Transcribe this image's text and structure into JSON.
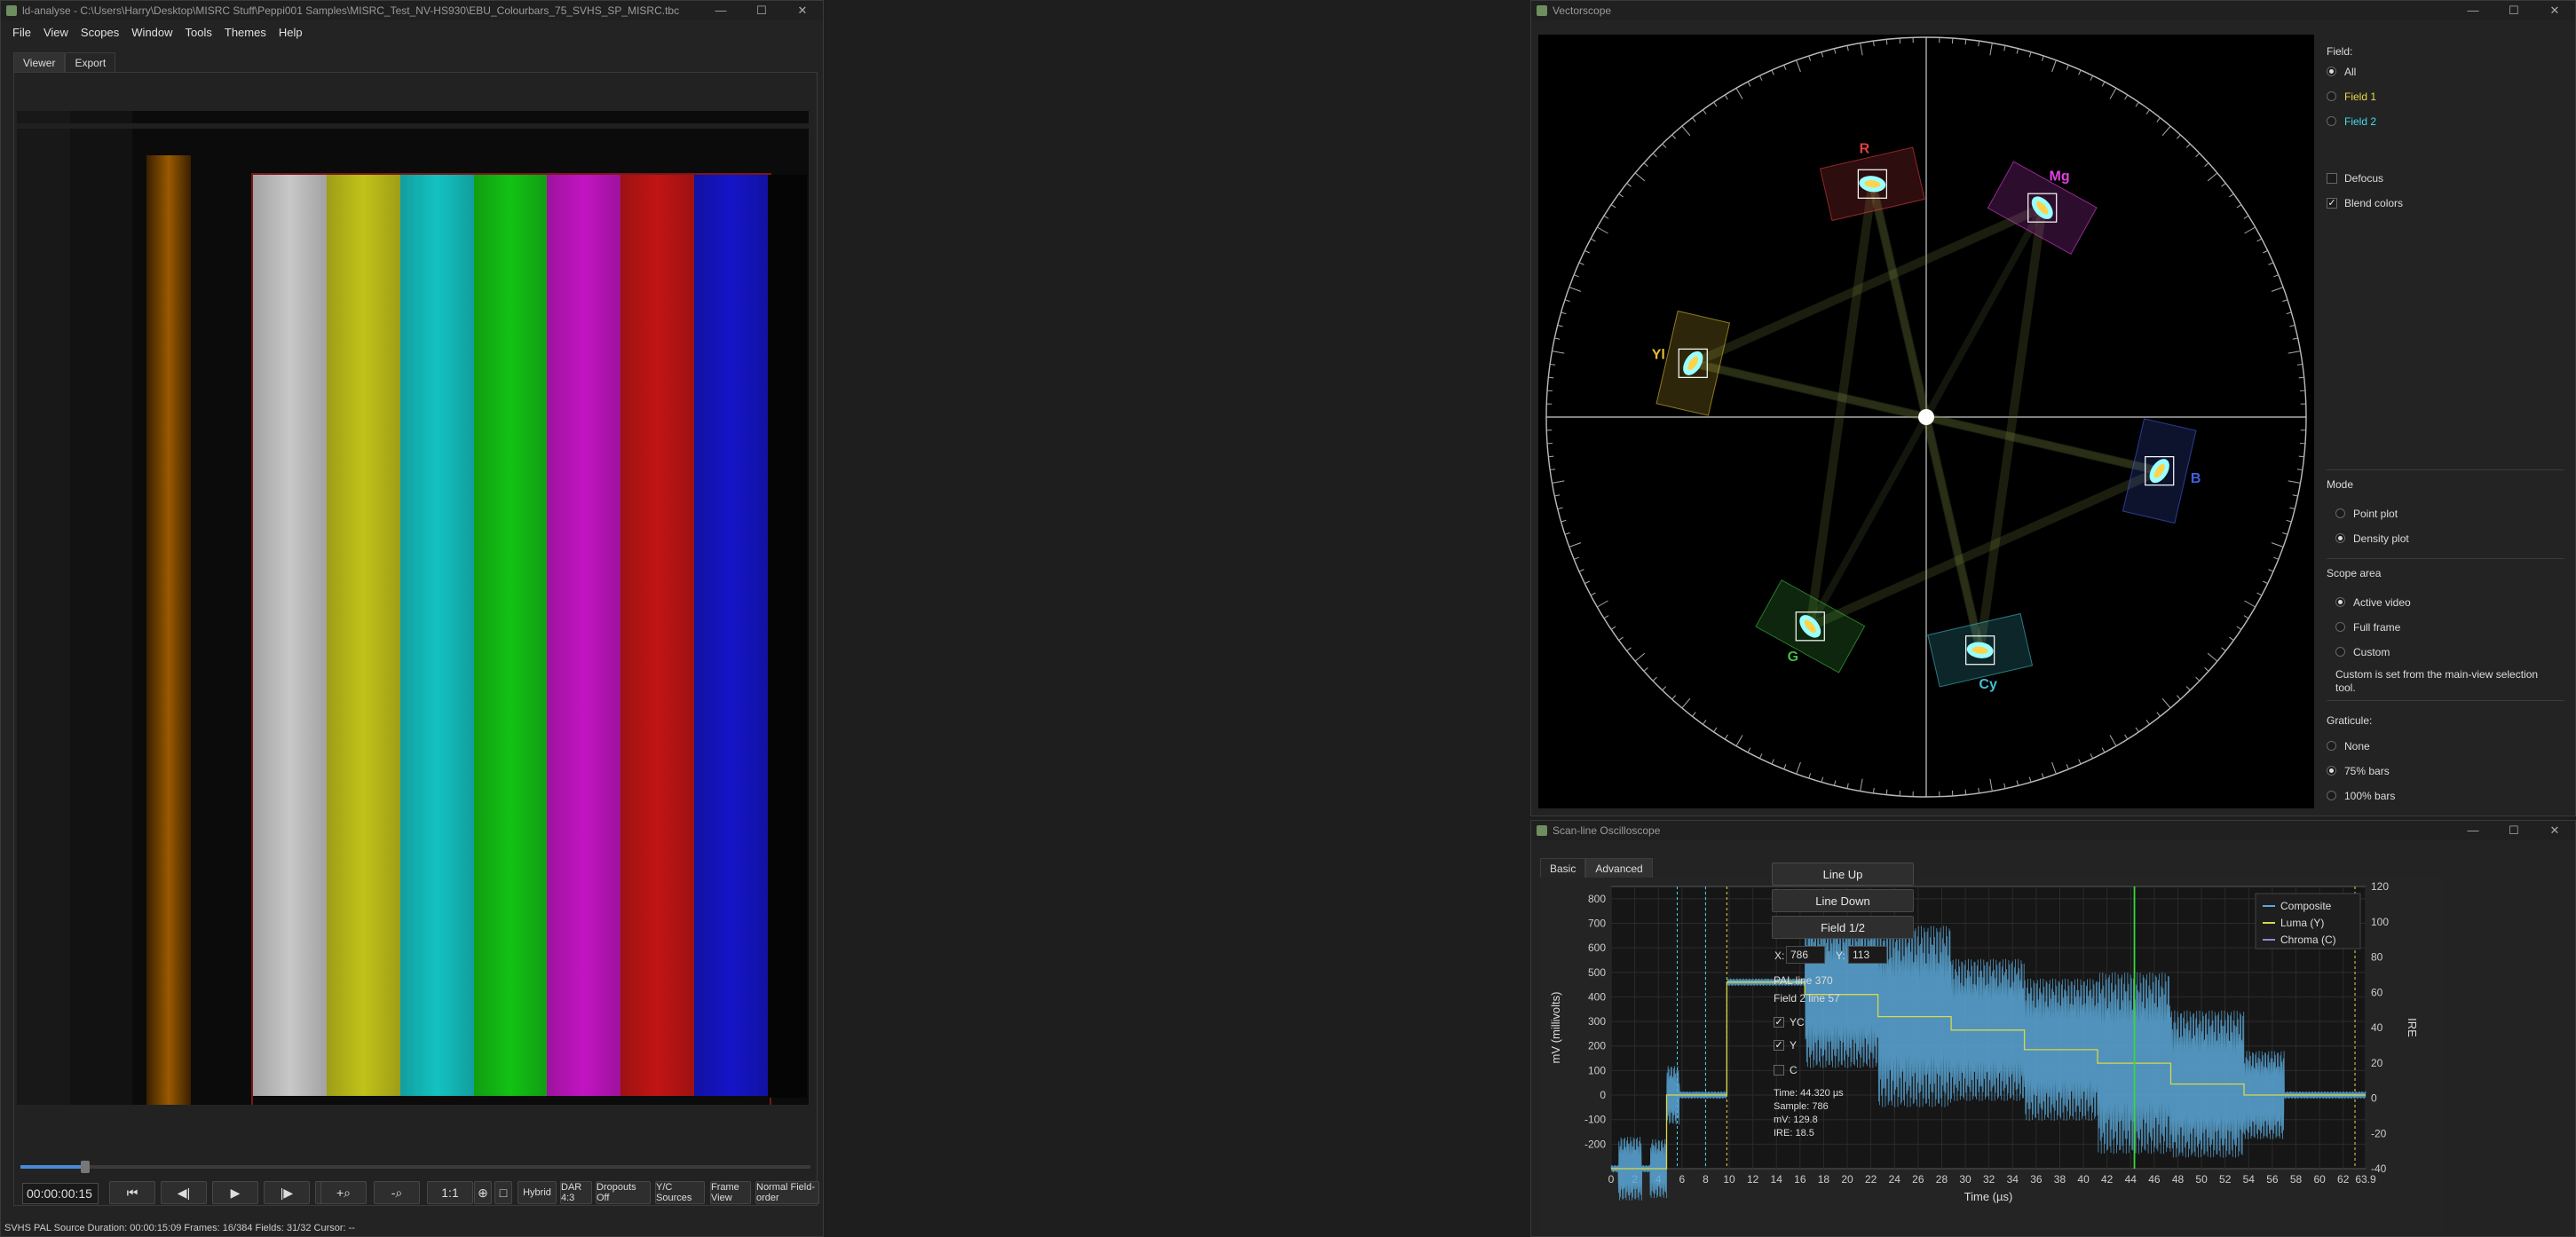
{
  "main": {
    "title": "ld-analyse - C:\\Users\\Harry\\Desktop\\MISRC Stuff\\Peppi001 Samples\\MISRC_Test_NV-HS930\\EBU_Colourbars_75_SVHS_SP_MISRC.tbc",
    "menu": [
      "File",
      "View",
      "Scopes",
      "Window",
      "Tools",
      "Themes",
      "Help"
    ],
    "tabs": [
      "Viewer",
      "Export"
    ],
    "timecode": "00:00:00:15",
    "transport": [
      "⏮",
      "◀|",
      "▶",
      "|▶",
      "⏭"
    ],
    "zoom": [
      "+⌕",
      "-⌕",
      "1:1"
    ],
    "toggles": [
      "Hybrid",
      "DAR 4:3",
      "Dropouts Off",
      "Y/C Sources",
      "Frame View",
      "Normal Field-order"
    ],
    "status": "SVHS PAL Source Duration: 00:00:15:09   Frames: 16/384 Fields: 31/32   Cursor: --",
    "bars": [
      "#c8c8c8",
      "#c2c21a",
      "#14c2c2",
      "#12c214",
      "#c214c2",
      "#c21414",
      "#1414c8"
    ]
  },
  "vectorscope": {
    "title": "Vectorscope",
    "field_label": "Field:",
    "field_options": [
      "All",
      "Field 1",
      "Field 2"
    ],
    "defocus": "Defocus",
    "blend": "Blend colors",
    "mode_label": "Mode",
    "mode_options": [
      "Point plot",
      "Density plot"
    ],
    "area_label": "Scope area",
    "area_options": [
      "Active video",
      "Full frame",
      "Custom"
    ],
    "custom_note": "Custom is set from the main-view selection tool.",
    "graticule_label": "Graticule:",
    "graticule_options": [
      "None",
      "75% bars",
      "100% bars"
    ],
    "targets": [
      {
        "name": "R",
        "angle": 103,
        "color": "#e04040"
      },
      {
        "name": "Mg",
        "angle": 61,
        "color": "#e040e0"
      },
      {
        "name": "B",
        "angle": -13,
        "color": "#4060e0"
      },
      {
        "name": "Cy",
        "angle": -77,
        "color": "#40c0d0"
      },
      {
        "name": "G",
        "angle": -119,
        "color": "#40c040"
      },
      {
        "name": "Yl",
        "angle": 167,
        "color": "#e0c030"
      }
    ]
  },
  "oscilloscope": {
    "title": "Scan-line Oscilloscope",
    "tabs": [
      "Basic",
      "Advanced"
    ],
    "buttons": [
      "Line Up",
      "Line Down",
      "Field 1/2"
    ],
    "x_label": "X:",
    "x_value": "786",
    "y_label": "Y:",
    "y_value": "113",
    "pal_line": "PAL line 370",
    "field_line": "Field 2 line 57",
    "yc": "YC",
    "y": "Y",
    "c": "C",
    "readout": [
      "Time: 44.320 µs",
      "Sample: 786",
      "mV: 129.8",
      "IRE: 18.5"
    ],
    "legend": [
      "Composite",
      "Luma (Y)",
      "Chroma (C)"
    ],
    "xlabel": "Time (µs)",
    "ylabel": "mV (millivolts)",
    "ylabel2": "IRE"
  },
  "chart_data": {
    "type": "line",
    "xlabel": "Time (µs)",
    "ylabel": "mV (millivolts)",
    "ylabel2": "IRE",
    "xlim": [
      0,
      63.9
    ],
    "ylim": [
      -300,
      850
    ],
    "ylim2": [
      -40,
      120
    ],
    "x_ticks": [
      "0",
      "2",
      "4",
      "6",
      "8",
      "10",
      "12",
      "14",
      "16",
      "18",
      "20",
      "22",
      "24",
      "26",
      "28",
      "30",
      "32",
      "34",
      "36",
      "38",
      "40",
      "42",
      "44",
      "46",
      "48",
      "50",
      "52",
      "54",
      "56",
      "58",
      "60",
      "62",
      "63.9"
    ],
    "y_ticks": [
      -200,
      -100,
      0,
      100,
      200,
      300,
      400,
      500,
      600,
      700,
      800
    ],
    "y2_ticks": [
      -40,
      -20,
      0,
      20,
      40,
      60,
      80,
      100,
      120
    ],
    "cursor_x": 44.32,
    "luma_segments": [
      {
        "x0": 0,
        "x1": 4.7,
        "v": -300
      },
      {
        "x0": 4.7,
        "x1": 9.8,
        "v": 0
      },
      {
        "x0": 9.8,
        "x1": 16.4,
        "v": 460
      },
      {
        "x0": 16.4,
        "x1": 22.6,
        "v": 410
      },
      {
        "x0": 22.6,
        "x1": 28.8,
        "v": 320
      },
      {
        "x0": 28.8,
        "x1": 35.0,
        "v": 265
      },
      {
        "x0": 35.0,
        "x1": 41.2,
        "v": 185
      },
      {
        "x0": 41.2,
        "x1": 47.4,
        "v": 130
      },
      {
        "x0": 47.4,
        "x1": 53.6,
        "v": 45
      },
      {
        "x0": 53.6,
        "x1": 63.9,
        "v": 0
      }
    ],
    "chroma_amplitude": [
      {
        "x0": 0.6,
        "x1": 2.6,
        "a": 130
      },
      {
        "x0": 3.3,
        "x1": 5.8,
        "a": 120
      },
      {
        "x0": 16.4,
        "x1": 22.6,
        "a": 300
      },
      {
        "x0": 22.6,
        "x1": 28.8,
        "a": 370
      },
      {
        "x0": 28.8,
        "x1": 35.0,
        "a": 290
      },
      {
        "x0": 35.0,
        "x1": 41.2,
        "a": 290
      },
      {
        "x0": 41.2,
        "x1": 47.4,
        "a": 370
      },
      {
        "x0": 47.4,
        "x1": 53.6,
        "a": 300
      },
      {
        "x0": 53.6,
        "x1": 57.0,
        "a": 180
      }
    ],
    "series": [
      {
        "name": "Composite",
        "color": "#5aa8d8"
      },
      {
        "name": "Luma (Y)",
        "color": "#d8d84a"
      },
      {
        "name": "Chroma (C)",
        "color": "#8a8ad8"
      }
    ]
  }
}
